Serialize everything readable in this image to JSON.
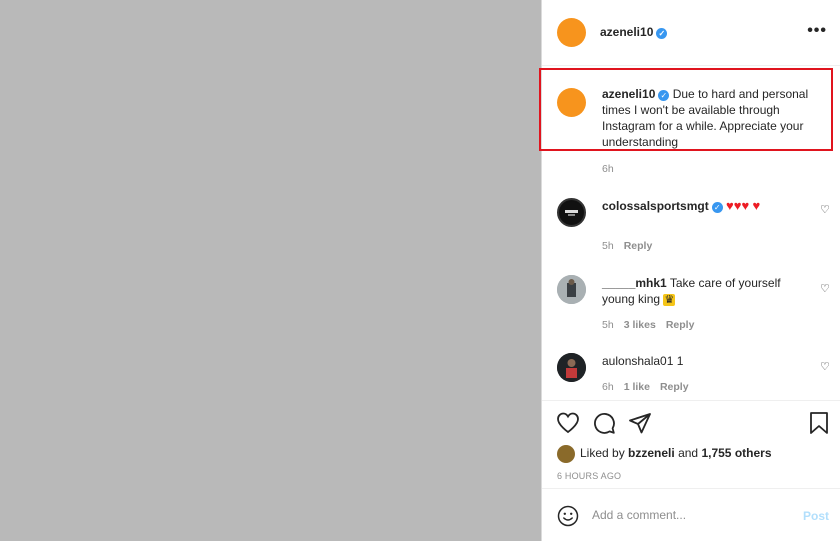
{
  "header": {
    "username": "azeneli10",
    "more_icon": "more-options-icon"
  },
  "caption": {
    "username": "azeneli10",
    "text": "Due to hard and personal times I won't be available through Instagram for a while. Appreciate your understanding",
    "time": "6h"
  },
  "comments": [
    {
      "username": "colossalsportsmgt",
      "text": "",
      "time": "5h",
      "likes": "",
      "reply": "Reply"
    },
    {
      "username": "_____mhk1",
      "text": "Take care of yourself young king",
      "time": "5h",
      "likes": "3 likes",
      "reply": "Reply"
    },
    {
      "username": "aulonshala01",
      "text": "1",
      "time": "6h",
      "likes": "1 like",
      "reply": "Reply"
    }
  ],
  "likes": {
    "prefix": "Liked by",
    "user": "bzzeneli",
    "and": "and",
    "others": "1,755 others"
  },
  "posted": "6 HOURS AGO",
  "add_comment": {
    "placeholder": "Add a comment...",
    "post_label": "Post"
  },
  "colors": {
    "accent": "#3897f0",
    "highlight_border": "#e0141e",
    "avatar": "#f7941d",
    "media": "#b9b9b9"
  }
}
